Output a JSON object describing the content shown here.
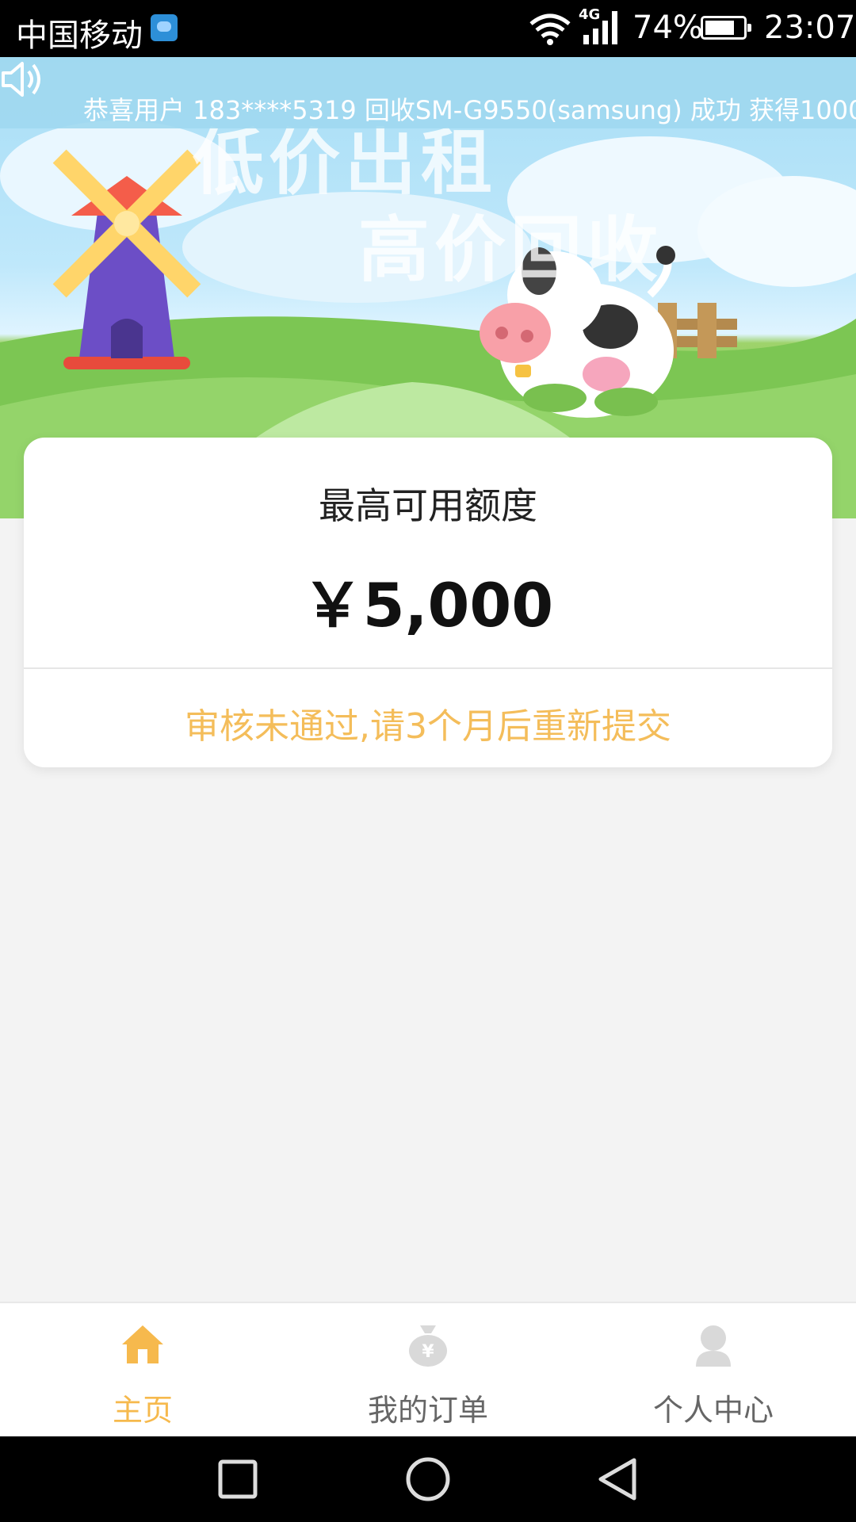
{
  "status_bar": {
    "carrier": "中国移动",
    "network_type": "4G",
    "battery_percent": "74%",
    "time": "23:07"
  },
  "banner": {
    "notice": "恭喜用户 183****5319 回收SM-G9550(samsung) 成功 获得1000",
    "title_line1": "低价出租",
    "title_line2": "高价回收"
  },
  "credit_card": {
    "label": "最高可用额度",
    "amount": "￥5,000",
    "status_message": "审核未通过,请3个月后重新提交"
  },
  "tab_bar": {
    "tabs": [
      {
        "label": "主页",
        "icon": "home-icon",
        "active": true
      },
      {
        "label": "我的订单",
        "icon": "money-bag-icon",
        "active": false
      },
      {
        "label": "个人中心",
        "icon": "user-icon",
        "active": false
      }
    ]
  },
  "colors": {
    "accent": "#f6b94d",
    "status_warning": "#f4bd5a",
    "inactive_icon": "#d9d9d9"
  }
}
